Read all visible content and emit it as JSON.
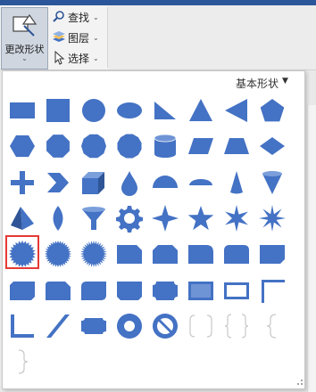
{
  "ribbon": {
    "change_shape_label": "更改形状",
    "find_label": "查找",
    "layer_label": "图层",
    "select_label": "选择"
  },
  "gallery": {
    "category_title": "基本形状",
    "shape_color": "#4472c4",
    "selected_shape": "seal-24-point",
    "shapes": [
      "rectangle",
      "square",
      "circle",
      "ellipse",
      "right-triangle",
      "isosceles-triangle",
      "left-triangle",
      "pentagon",
      "hexagon",
      "octagon",
      "decagon",
      "dodecagon",
      "cylinder",
      "parallelogram",
      "trapezoid",
      "diamond",
      "plus",
      "chevron",
      "cube",
      "teardrop",
      "half-circle",
      "chord",
      "tall-triangle",
      "inverted-cone",
      "pyramid",
      "lens",
      "funnel",
      "gear",
      "star-4",
      "star-5",
      "star-6",
      "star-8",
      "seal-24-point",
      "seal-32-point",
      "seal-point-starburst",
      "snip-corner-rect",
      "snip-same-side-rect",
      "round-one-corner-rect",
      "round-same-side-rect",
      "folded-rect",
      "snip-diagonal-rect",
      "snip-round-rect",
      "round-diagonal-rect",
      "snip-side-rect",
      "plaque",
      "bevel-rect",
      "frame",
      "half-frame",
      "l-shape",
      "diagonal-stripe",
      "plaque-rounded",
      "donut",
      "no-symbol",
      "double-bracket",
      "double-brace",
      "left-brace",
      "right-brace"
    ]
  }
}
